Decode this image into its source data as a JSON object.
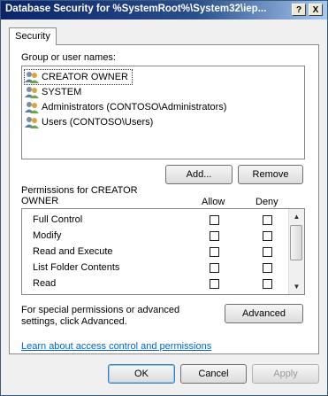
{
  "window": {
    "title": "Database Security for %SystemRoot%\\System32\\iep...",
    "help_glyph": "?",
    "close_glyph": "X"
  },
  "tabs": [
    {
      "label": "Security",
      "active": true
    }
  ],
  "groups": {
    "label": "Group or user names:",
    "items": [
      {
        "name": "CREATOR OWNER",
        "selected": true
      },
      {
        "name": "SYSTEM",
        "selected": false
      },
      {
        "name": "Administrators (CONTOSO\\Administrators)",
        "selected": false
      },
      {
        "name": "Users (CONTOSO\\Users)",
        "selected": false
      }
    ],
    "add_label": "Add...",
    "remove_label": "Remove"
  },
  "permissions": {
    "label": "Permissions for CREATOR OWNER",
    "allow_header": "Allow",
    "deny_header": "Deny",
    "rows": [
      {
        "name": "Full Control",
        "allow": false,
        "deny": false
      },
      {
        "name": "Modify",
        "allow": false,
        "deny": false
      },
      {
        "name": "Read and Execute",
        "allow": false,
        "deny": false
      },
      {
        "name": "List Folder Contents",
        "allow": false,
        "deny": false
      },
      {
        "name": "Read",
        "allow": false,
        "deny": false
      }
    ]
  },
  "advanced": {
    "text": "For special permissions or advanced settings, click Advanced.",
    "button_label": "Advanced"
  },
  "help_link": "Learn about access control and permissions",
  "footer": {
    "ok_label": "OK",
    "cancel_label": "Cancel",
    "apply_label": "Apply"
  },
  "colors": {
    "title_bar": "#0a246a",
    "link": "#0066cc"
  }
}
